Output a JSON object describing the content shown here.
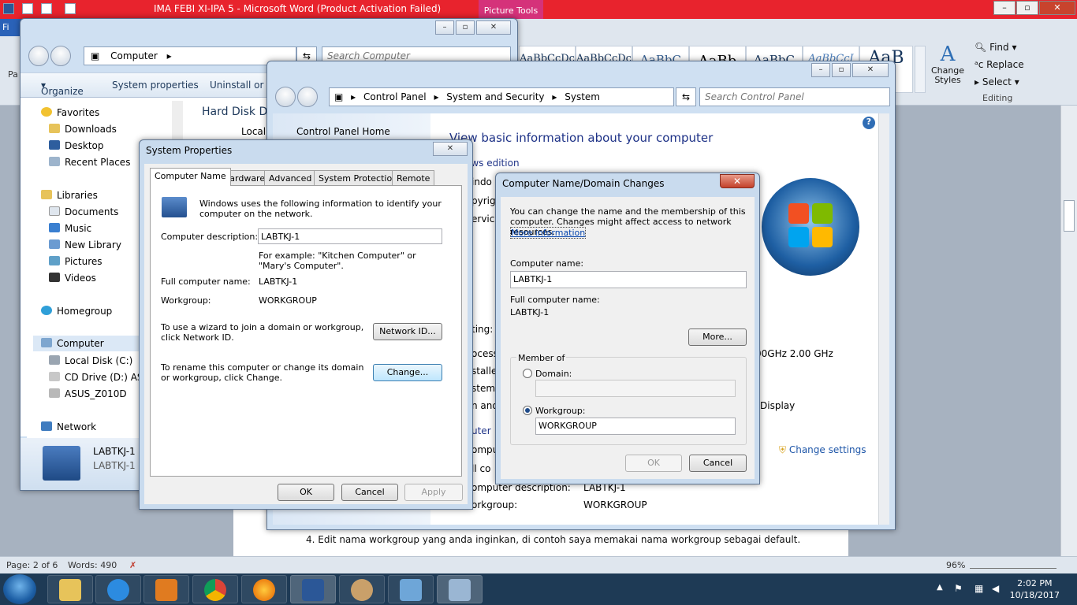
{
  "word": {
    "title": "IMA FEBI XI-IPA 5  -  Microsoft Word (Product Activation Failed)",
    "context_tab": "Picture Tools",
    "file_tab": "Fi",
    "paste_label": "Pa",
    "styles": [
      "AaBbCcDc",
      "AaBbCcDc",
      "AaBbC",
      "AaBb",
      "AaBbC",
      "AaBbCcI",
      "AaB"
    ],
    "change_styles": "Change Styles",
    "editing": {
      "find": "Find",
      "replace": "Replace",
      "select": "Select",
      "group": "Editing"
    },
    "doc_text": "4. Edit nama workgroup yang anda inginkan, di contoh saya memakai nama workgroup sebagai default.",
    "status": {
      "page": "Page: 2 of 6",
      "words": "Words: 490",
      "zoom": "96%"
    }
  },
  "explorer": {
    "address": "Computer",
    "search_placeholder": "Search Computer",
    "toolbar": {
      "organize": "Organize",
      "system_properties": "System properties",
      "uninstall": "Uninstall or c"
    },
    "nav": {
      "favorites": "Favorites",
      "downloads": "Downloads",
      "desktop": "Desktop",
      "recent": "Recent Places",
      "libraries": "Libraries",
      "documents": "Documents",
      "music": "Music",
      "new_library": "New Library",
      "pictures": "Pictures",
      "videos": "Videos",
      "homegroup": "Homegroup",
      "computer": "Computer",
      "local_disk": "Local Disk (C:)",
      "cd_drive": "CD Drive (D:) ASU",
      "asus": "ASUS_Z010D",
      "network": "Network"
    },
    "content_heading": "Hard Disk Dr",
    "content_sub": "Local D",
    "details_name": "LABTKJ-1",
    "details_sub": "LABTKJ-1"
  },
  "system": {
    "breadcrumb": {
      "cp": "Control Panel",
      "sec": "System and Security",
      "sys": "System"
    },
    "search_placeholder": "Search Control Panel",
    "left_home": "Control Panel Home",
    "heading": "View basic information about your computer",
    "edition_frag": "ows edition",
    "frag_window": "indo",
    "frag_copyright": "pyrig",
    "frag_service": "ervice",
    "frag_on": "n",
    "frag_rating": "ting:",
    "frag_processor": "ocess",
    "frag_installed": "stalled",
    "frag_system": "stem",
    "frag_pen": "n and",
    "frag_computer": "uter",
    "frag_compu": "ompu",
    "frag_full": "ll co",
    "frag_desc": "omputer description:",
    "frag_desc_val": "LABTKJ-1",
    "workgroup_label": "orkgroup:",
    "workgroup_value": "WORKGROUP",
    "cpu_speed": "00GHz   2.00 GHz",
    "display_frag": "Display",
    "change_settings": "Change settings"
  },
  "sysprop": {
    "title": "System Properties",
    "tabs": [
      "Computer Name",
      "Hardware",
      "Advanced",
      "System Protection",
      "Remote"
    ],
    "intro": "Windows uses the following information to identify your computer on the network.",
    "desc_label": "Computer description:",
    "desc_value": "LABTKJ-1",
    "example": "For example: \"Kitchen Computer\" or \"Mary's Computer\".",
    "full_name_label": "Full computer name:",
    "full_name_value": "LABTKJ-1",
    "workgroup_label": "Workgroup:",
    "workgroup_value": "WORKGROUP",
    "wizard_text": "To use a wizard to join a domain or workgroup, click Network ID.",
    "network_id": "Network ID...",
    "rename_text": "To rename this computer or change its domain or workgroup, click Change.",
    "change": "Change...",
    "ok": "OK",
    "cancel": "Cancel",
    "apply": "Apply"
  },
  "domain": {
    "title": "Computer Name/Domain Changes",
    "intro": "You can change the name and the membership of this computer. Changes might affect access to network resources.",
    "more_info": "More information",
    "name_label": "Computer name:",
    "name_value": "LABTKJ-1",
    "full_label": "Full computer name:",
    "full_value": "LABTKJ-1",
    "more": "More...",
    "member_of": "Member of",
    "domain_label": "Domain:",
    "domain_value": "",
    "workgroup_label": "Workgroup:",
    "workgroup_value": "WORKGROUP",
    "ok": "OK",
    "cancel": "Cancel"
  },
  "taskbar": {
    "time": "2:02 PM",
    "date": "10/18/2017"
  }
}
